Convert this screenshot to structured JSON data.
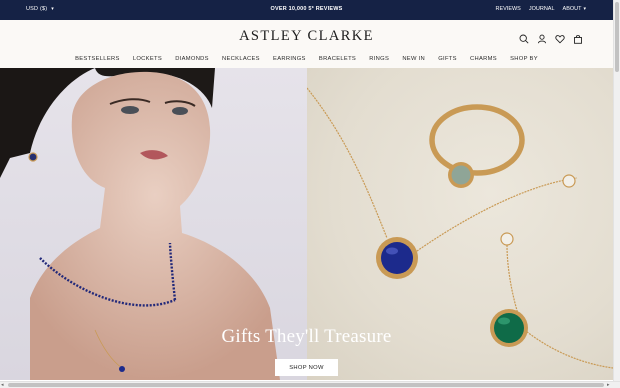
{
  "topbar": {
    "currency": "USD ($)",
    "promo": "OVER 10,000 5* REVIEWS",
    "links": [
      "REVIEWS",
      "JOURNAL",
      "ABOUT"
    ]
  },
  "header": {
    "logo": "ASTLEY CLARKE",
    "icons": [
      "search-icon",
      "account-icon",
      "wishlist-heart-icon",
      "bag-icon"
    ]
  },
  "nav": {
    "items": [
      "BESTSELLERS",
      "LOCKETS",
      "DIAMONDS",
      "NECKLACES",
      "EARRINGS",
      "BRACELETS",
      "RINGS",
      "NEW IN",
      "GIFTS",
      "CHARMS",
      "SHOP BY"
    ]
  },
  "hero": {
    "headline": "Gifts They'll Treasure",
    "cta": "SHOP NOW"
  },
  "colors": {
    "topbar_bg": "#152245",
    "header_bg": "#fbf9f6",
    "gold": "#c99a55",
    "sapphire": "#1c2a8c",
    "emerald": "#0f6b48"
  }
}
